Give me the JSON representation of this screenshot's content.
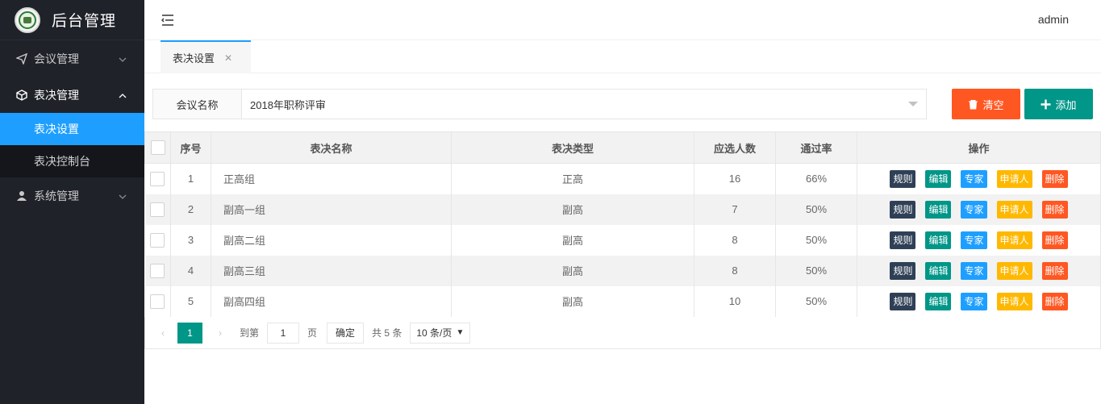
{
  "app": {
    "title": "后台管理"
  },
  "header": {
    "user": "admin"
  },
  "sidebar": {
    "items": [
      {
        "label": "会议管理",
        "icon": "send-icon",
        "open": false
      },
      {
        "label": "表决管理",
        "icon": "cube-icon",
        "open": true,
        "children": [
          {
            "label": "表决设置",
            "active": true
          },
          {
            "label": "表决控制台",
            "active": false
          }
        ]
      },
      {
        "label": "系统管理",
        "icon": "user-icon",
        "open": false
      }
    ]
  },
  "tabs": [
    {
      "label": "表决设置",
      "close": "✕"
    }
  ],
  "filter": {
    "label": "会议名称",
    "value": "2018年职称评审"
  },
  "toolbar": {
    "clear_label": "清空",
    "add_label": "添加"
  },
  "table": {
    "headers": [
      "序号",
      "表决名称",
      "表决类型",
      "应选人数",
      "通过率",
      "操作"
    ],
    "rows": [
      {
        "no": "1",
        "name": "正高组",
        "type": "正高",
        "count": "16",
        "rate": "66%"
      },
      {
        "no": "2",
        "name": "副高一组",
        "type": "副高",
        "count": "7",
        "rate": "50%"
      },
      {
        "no": "3",
        "name": "副高二组",
        "type": "副高",
        "count": "8",
        "rate": "50%"
      },
      {
        "no": "4",
        "name": "副高三组",
        "type": "副高",
        "count": "8",
        "rate": "50%"
      },
      {
        "no": "5",
        "name": "副高四组",
        "type": "副高",
        "count": "10",
        "rate": "50%"
      }
    ],
    "actions": {
      "rule": "规则",
      "edit": "编辑",
      "expert": "专家",
      "applicant": "申请人",
      "delete": "删除"
    }
  },
  "pager": {
    "prev": "‹",
    "next": "›",
    "current": "1",
    "goto_label": "到第",
    "goto_value": "1",
    "page_unit": "页",
    "confirm": "确定",
    "total": "共 5 条",
    "page_size": "10 条/页"
  },
  "colors": {
    "sidebar_bg": "#20222a",
    "active": "#1e9fff",
    "teal": "#009688",
    "orange": "#ff5722",
    "yellow": "#ffb800",
    "dark": "#2f4056"
  }
}
